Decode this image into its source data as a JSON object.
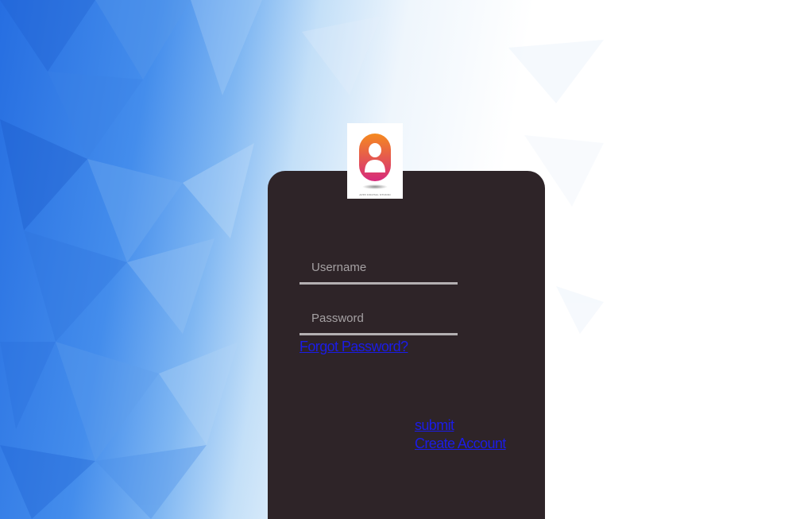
{
  "login_form": {
    "username_placeholder": "Username",
    "password_placeholder": "Password",
    "forgot_password_label": "Forgot Password?",
    "submit_label": "submit",
    "create_account_label": "Create Account"
  },
  "logo": {
    "icon": "user-avatar-icon",
    "caption": "AVIN DIGITAL STUDIO"
  },
  "colors": {
    "card_background": "#2e2428",
    "link": "#1b1ce6",
    "field_underline": "#b4b0b2",
    "background_blue": "#266ee1",
    "avatar_gradient_top": "#f58a1f",
    "avatar_gradient_bottom": "#d62a7c"
  }
}
